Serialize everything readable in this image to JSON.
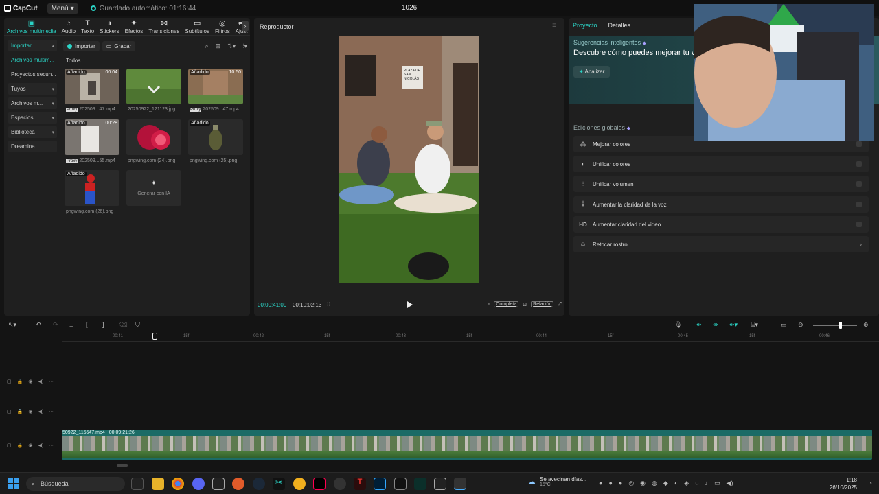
{
  "titlebar": {
    "app": "CapCut",
    "menu_label": "Menú",
    "autosave": "Guardado automático: 01:16:44",
    "project_title": "1026"
  },
  "toolbar": {
    "tabs": [
      {
        "label": "Archivos multimedia",
        "icon": "media-icon"
      },
      {
        "label": "Audio",
        "icon": "audio-icon"
      },
      {
        "label": "Texto",
        "icon": "text-icon"
      },
      {
        "label": "Stickers",
        "icon": "sticker-icon"
      },
      {
        "label": "Efectos",
        "icon": "effects-icon"
      },
      {
        "label": "Transiciones",
        "icon": "transition-icon"
      },
      {
        "label": "Subtítulos",
        "icon": "subtitle-icon"
      },
      {
        "label": "Filtros",
        "icon": "filter-icon"
      },
      {
        "label": "Ajust",
        "icon": "adjust-icon"
      }
    ]
  },
  "sidebar": {
    "items": [
      {
        "label": "Importar"
      },
      {
        "label": "Archivos multim..."
      },
      {
        "label": "Proyectos secun..."
      },
      {
        "label": "Tuyos"
      },
      {
        "label": "Archivos m..."
      },
      {
        "label": "Espacios"
      },
      {
        "label": "Biblioteca"
      },
      {
        "label": "Dreamina"
      }
    ]
  },
  "media": {
    "import_label": "Importar",
    "record_label": "Grabar",
    "section": "Todos",
    "items": [
      {
        "badge": "Añadido",
        "duration": "00:04",
        "proxy": "Proxy",
        "name": "202509...47.mp4"
      },
      {
        "badge": "",
        "duration": "",
        "proxy": "",
        "name": "20250922_121123.jpg"
      },
      {
        "badge": "Añadido",
        "duration": "10:50",
        "proxy": "Proxy",
        "name": "202509...47.mp4"
      },
      {
        "badge": "Añadido",
        "duration": "00:28",
        "proxy": "Proxy",
        "name": "202509...55.mp4"
      },
      {
        "badge": "",
        "duration": "",
        "proxy": "",
        "name": "pngwing.com (24).png"
      },
      {
        "badge": "Añadido",
        "duration": "",
        "proxy": "",
        "name": "pngwing.com (25).png"
      },
      {
        "badge": "Añadido",
        "duration": "",
        "proxy": "",
        "name": "pngwing.com (26).png"
      }
    ],
    "generate_label": "Generar con IA"
  },
  "player": {
    "title": "Reproductor",
    "time_current": "00:00:41:09",
    "time_total": "00:10:02:13",
    "full_label": "Completa",
    "ratio_label": "Relación",
    "sign_text": "PLAZA DE SAN NICOLÁS"
  },
  "props": {
    "tab_project": "Proyecto",
    "tab_details": "Detalles",
    "suggest_title": "Sugerencias inteligentes",
    "suggest_head": "Descubre cómo puedes mejorar tu v",
    "analyze_label": "Analizar",
    "global_title": "Ediciones globales",
    "edits": [
      {
        "label": "Mejorar colores",
        "icon": "magic-wand-icon"
      },
      {
        "label": "Unificar colores",
        "icon": "color-match-icon"
      },
      {
        "label": "Unificar volumen",
        "icon": "volume-icon"
      },
      {
        "label": "Aumentar la claridad de la voz",
        "icon": "voice-icon"
      },
      {
        "label": "Aumentar claridad del video",
        "icon": "hd-icon",
        "icon_text": "HD"
      },
      {
        "label": "Retocar rostro",
        "icon": "face-icon"
      }
    ]
  },
  "timeline": {
    "ruler": [
      "00:41",
      "15f",
      "00:42",
      "15f",
      "00:43",
      "15f",
      "00:44",
      "15f",
      "00:45",
      "15f",
      "00:46"
    ],
    "clip_name": "50922_115547.mp4",
    "clip_duration": "00:09:21:26"
  },
  "taskbar": {
    "search_placeholder": "Búsqueda",
    "weather_line1": "Se avecinan días...",
    "weather_line2": "15°C",
    "time": "1:18",
    "date": "26/10/2025"
  },
  "colors": {
    "accent": "#2bd4c6",
    "clip": "#1b6b66"
  }
}
